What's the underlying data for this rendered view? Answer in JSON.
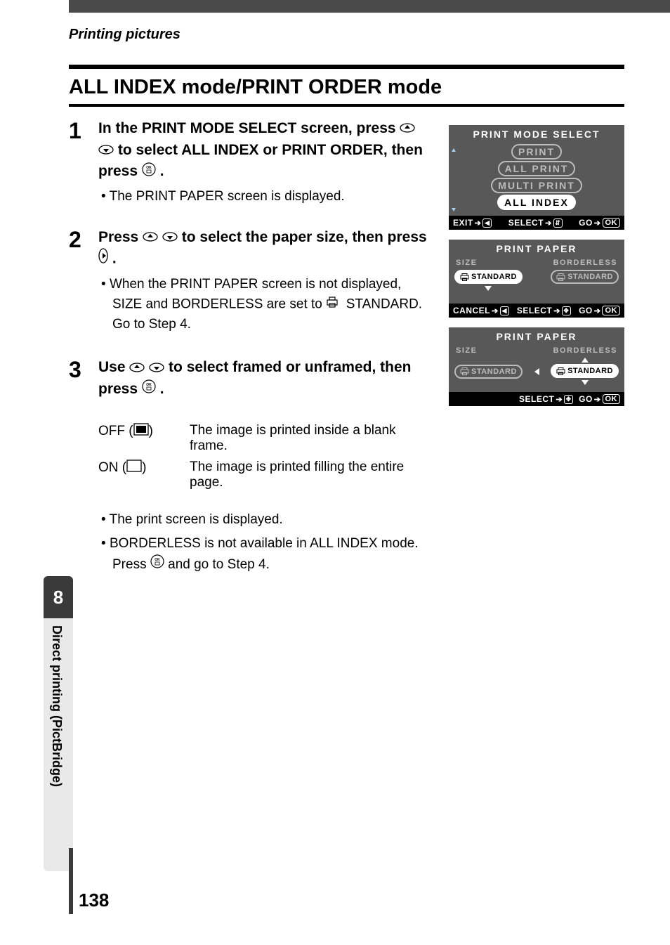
{
  "breadcrumb": "Printing pictures",
  "title": "ALL INDEX mode/PRINT ORDER mode",
  "steps": {
    "s1": {
      "num": "1",
      "instr_parts": {
        "a": "In the PRINT MODE SELECT screen, press ",
        "b": " to select ALL INDEX or PRINT ORDER, then press ",
        "c": "."
      },
      "note": "The PRINT PAPER screen is displayed."
    },
    "s2": {
      "num": "2",
      "instr_parts": {
        "a": "Press ",
        "b": " to select the paper size, then press ",
        "c": "."
      },
      "note": "When the PRINT PAPER screen is not displayed, SIZE and BORDERLESS are set to      STANDARD. Go to Step 4."
    },
    "s3": {
      "num": "3",
      "instr_parts": {
        "a": "Use ",
        "b": " to select framed or unframed, then press ",
        "c": "."
      },
      "table": {
        "off_label": "OFF (",
        "off_label2": ")",
        "off_desc": "The image is printed inside a blank frame.",
        "on_label": "ON (",
        "on_label2": ")",
        "on_desc": "The image is printed filling the entire page."
      },
      "note1": "The print screen is displayed.",
      "note2a": "BORDERLESS is not available in ALL INDEX mode.",
      "note2b": "Press ",
      "note2c": " and go to Step 4."
    }
  },
  "side": {
    "chapter": "8",
    "label": "Direct printing (PictBridge)"
  },
  "page": "138",
  "screens": {
    "s1": {
      "title": "PRINT MODE SELECT",
      "items": [
        "PRINT",
        "ALL PRINT",
        "MULTI PRINT",
        "ALL INDEX"
      ],
      "footer": {
        "exit": "EXIT",
        "select": "SELECT",
        "go": "GO",
        "ok": "OK"
      }
    },
    "s2": {
      "title": "PRINT PAPER",
      "left_label": "SIZE",
      "right_label": "BORDERLESS",
      "left_pill": "STANDARD",
      "right_pill": "STANDARD",
      "footer": {
        "cancel": "CANCEL",
        "select": "SELECT",
        "go": "GO",
        "ok": "OK"
      }
    },
    "s3": {
      "title": "PRINT PAPER",
      "left_label": "SIZE",
      "right_label": "BORDERLESS",
      "left_pill": "STANDARD",
      "right_pill": "STANDARD",
      "footer": {
        "select": "SELECT",
        "go": "GO",
        "ok": "OK"
      }
    }
  }
}
